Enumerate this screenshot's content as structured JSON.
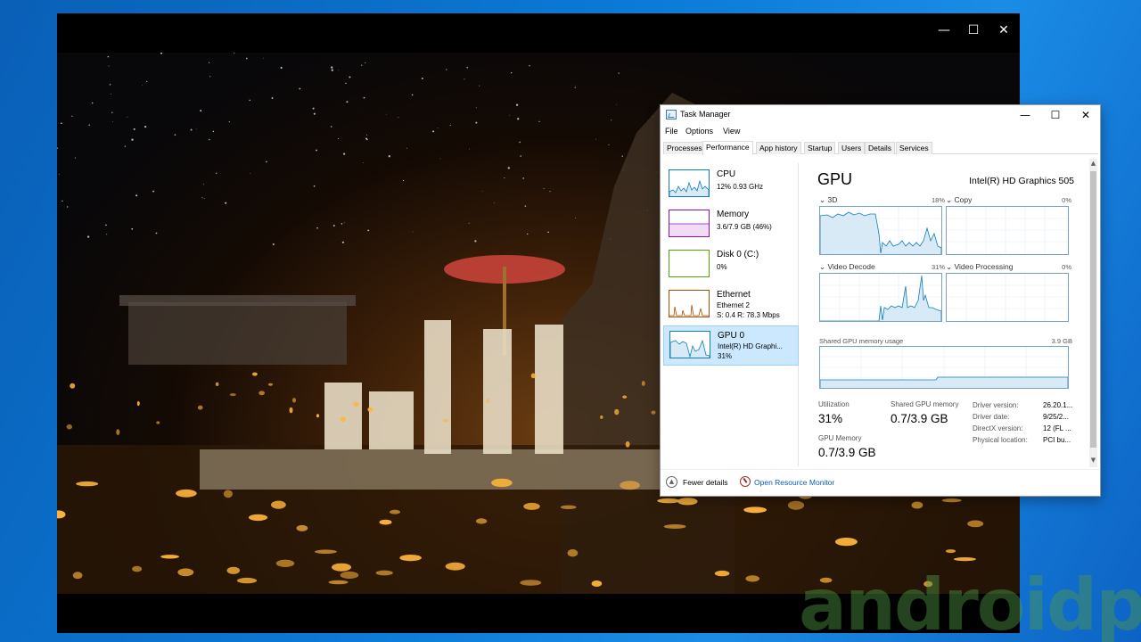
{
  "viewer": {
    "controls": {
      "minimize": "—",
      "maximize": "☐",
      "close": "✕"
    }
  },
  "task_manager": {
    "title": "Task Manager",
    "controls": {
      "minimize": "—",
      "maximize": "☐",
      "close": "✕"
    },
    "menu": [
      "File",
      "Options",
      "View"
    ],
    "tabs": [
      "Processes",
      "Performance",
      "App history",
      "Startup",
      "Users",
      "Details",
      "Services"
    ],
    "active_tab": "Performance",
    "resources": [
      {
        "name": "CPU",
        "line1": "12%  0.93 GHz",
        "line2": "",
        "color": "#117dbb"
      },
      {
        "name": "Memory",
        "line1": "3.6/7.9 GB (46%)",
        "line2": "",
        "color": "#8b12ae"
      },
      {
        "name": "Disk 0 (C:)",
        "line1": "0%",
        "line2": "",
        "color": "#4da60c"
      },
      {
        "name": "Ethernet",
        "line1": "Ethernet 2",
        "line2": "S: 0.4  R: 78.3 Mbps",
        "color": "#a74f01"
      },
      {
        "name": "GPU 0",
        "line1": "Intel(R) HD Graphi...",
        "line2": "31%",
        "color": "#117dbb"
      }
    ],
    "gpu": {
      "title": "GPU",
      "model": "Intel(R) HD Graphics 505",
      "engines": [
        {
          "name": "3D",
          "percent": "18%"
        },
        {
          "name": "Copy",
          "percent": "0%"
        },
        {
          "name": "Video Decode",
          "percent": "31%"
        },
        {
          "name": "Video Processing",
          "percent": "0%"
        }
      ],
      "shared_memory_label": "Shared GPU memory usage",
      "shared_memory_max": "3.9 GB",
      "stats": {
        "utilization_label": "Utilization",
        "utilization_value": "31%",
        "shared_label": "Shared GPU memory",
        "shared_value": "0.7/3.9 GB",
        "gpu_memory_label": "GPU Memory",
        "gpu_memory_value": "0.7/3.9 GB"
      },
      "info": [
        {
          "key": "Driver version:",
          "value": "26.20.1..."
        },
        {
          "key": "Driver date:",
          "value": "9/25/2..."
        },
        {
          "key": "DirectX version:",
          "value": "12 (FL ..."
        },
        {
          "key": "Physical location:",
          "value": "PCI bu..."
        }
      ]
    },
    "footer": {
      "fewer_details": "Fewer details",
      "open_resource_monitor": "Open Resource Monitor"
    }
  },
  "watermark": "androidpc"
}
